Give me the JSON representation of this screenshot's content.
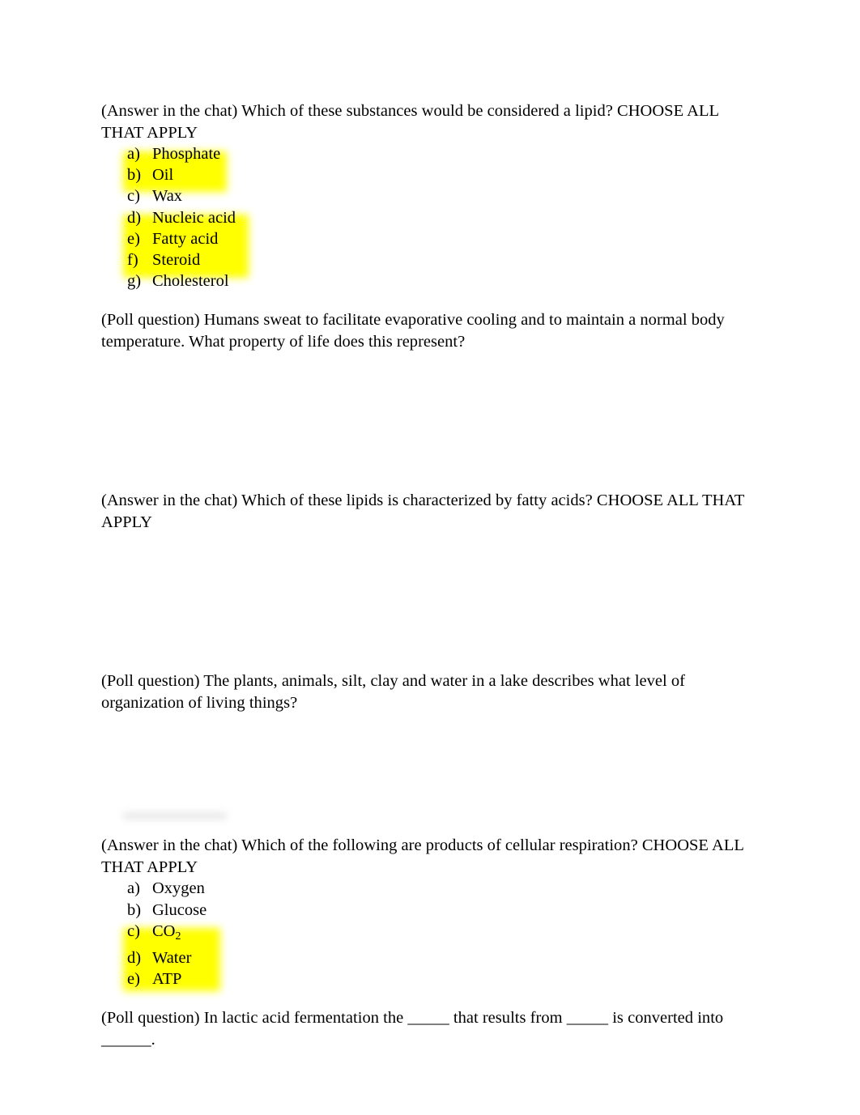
{
  "document": {
    "page_background": "#ffffff",
    "text_color": "#000000",
    "highlight_color": "#ffff00",
    "blocks": [
      {
        "id": "q1",
        "type": "question",
        "prompt": "(Answer in the chat) Which of these substances would be considered a lipid? CHOOSE ALL THAT APPLY",
        "choices": [
          {
            "marker": "a)",
            "text": "Phosphate",
            "highlighted": false
          },
          {
            "marker": "b)",
            "text": "Oil",
            "highlighted": true
          },
          {
            "marker": "c)",
            "text": "Wax",
            "highlighted": true
          },
          {
            "marker": "d)",
            "text": "Nucleic acid",
            "highlighted": false
          },
          {
            "marker": "e)",
            "text": "Fatty acid",
            "highlighted": true
          },
          {
            "marker": "f)",
            "text": "Steroid",
            "highlighted": true
          },
          {
            "marker": "g)",
            "text": "Cholesterol",
            "highlighted": true
          }
        ]
      },
      {
        "id": "q2",
        "type": "poll",
        "prompt": "(Poll question) Humans sweat to facilitate evaporative cooling and to maintain a normal body temperature. What property of life does this represent?",
        "choices": []
      },
      {
        "id": "q3",
        "type": "question",
        "prompt": "(Answer in the chat) Which of these lipids is characterized by fatty acids? CHOOSE ALL THAT APPLY",
        "choices": []
      },
      {
        "id": "q4",
        "type": "poll",
        "prompt": "(Poll question) The plants, animals, silt, clay and water in a lake describes what level of organization of living things?",
        "choices": []
      },
      {
        "id": "q5",
        "type": "question",
        "prompt": "(Answer in the chat) Which of the following are products of cellular respiration? CHOOSE ALL THAT APPLY",
        "choices": [
          {
            "marker": "a)",
            "text": "Oxygen",
            "highlighted": false
          },
          {
            "marker": "b)",
            "text": "Glucose",
            "highlighted": false
          },
          {
            "marker": "c)",
            "text": "CO",
            "subscript": "2",
            "highlighted": true
          },
          {
            "marker": "d)",
            "text": "Water",
            "highlighted": true
          },
          {
            "marker": "e)",
            "text": "ATP",
            "highlighted": true
          }
        ]
      },
      {
        "id": "q6",
        "type": "poll",
        "prompt_line1": "(Poll question) In lactic acid fermentation the _____ that results from _____ is converted into",
        "prompt_line2": "______."
      }
    ]
  }
}
